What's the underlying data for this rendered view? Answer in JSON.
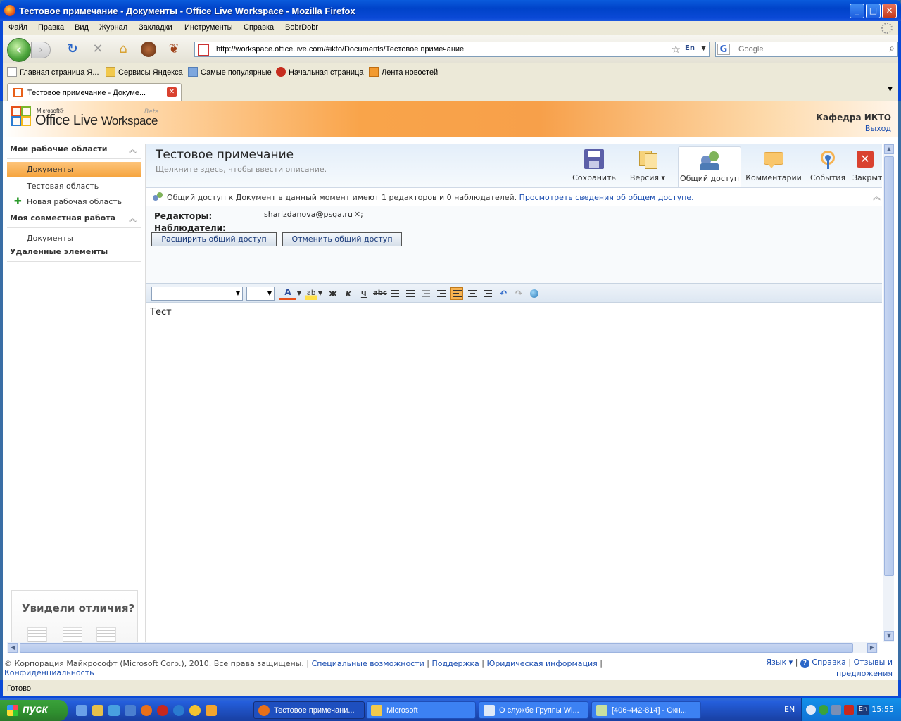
{
  "window": {
    "title": "Тестовое примечание - Документы - Office Live Workspace - Mozilla Firefox"
  },
  "menu": [
    "Файл",
    "Правка",
    "Вид",
    "Журнал",
    "Закладки",
    "Инструменты",
    "Справка",
    "BobrDobr"
  ],
  "nav": {
    "url": "http://workspace.office.live.com/#ikto/Documents/Тестовое примечание",
    "url_lang": "En",
    "search_placeholder": "Google"
  },
  "bookmarks": [
    "Главная страница Я...",
    "Сервисы Яндекса",
    "Самые популярные",
    "Начальная страница",
    "Лента новостей"
  ],
  "tab": {
    "label": "Тестовое примечание - Докуме..."
  },
  "brand": {
    "microsoft": "Microsoft®",
    "office_live": "Office Live",
    "workspace": "Workspace",
    "beta": "Beta"
  },
  "account": {
    "org": "Кафедра ИКТО",
    "logout": "Выход"
  },
  "sidebar": {
    "section1": "Мои рабочие области",
    "items1": [
      "Документы",
      "Тестовая область",
      "Новая рабочая область"
    ],
    "section2": "Моя совместная работа",
    "items2": [
      "Документы"
    ],
    "section3": "Удаленные элементы",
    "promo": "Увидели отличия?"
  },
  "document": {
    "title": "Тестовое примечание",
    "description": "Щелкните здесь, чтобы ввести описание.",
    "body": "Тест"
  },
  "toolbar": {
    "save": "Сохранить",
    "version": "Версия",
    "share": "Общий доступ",
    "comments": "Комментарии",
    "events": "События",
    "close": "Закрыть"
  },
  "share": {
    "info": "Общий доступ к Документ в данный момент имеют 1 редакторов и 0 наблюдателей.",
    "info_link": "Просмотреть сведения об общем доступе.",
    "editors_label": "Редакторы:",
    "viewers_label": "Наблюдатели:",
    "editor_email": "sharizdanova@psga.ru",
    "expand_button": "Расширить общий доступ",
    "cancel_button": "Отменить общий доступ"
  },
  "format": {
    "bold": "ж",
    "italic": "к",
    "underline": "ч",
    "strike": "abc"
  },
  "footer": {
    "copyright": "© Корпорация Майкрософт (Microsoft Corp.), 2010. Все права защищены.",
    "links": [
      "Специальные возможности",
      "Поддержка",
      "Юридическая информация",
      "Конфиденциальность"
    ],
    "language": "Язык",
    "help": "Справка",
    "feedback1": "Отзывы и",
    "feedback2": "предложения"
  },
  "status": "Готово",
  "taskbar": {
    "start": "пуск",
    "tasks": [
      "Тестовое примечани...",
      "Microsoft",
      "О службе Группы Wi...",
      "[406-442-814] - Окн..."
    ],
    "lang": "EN",
    "tray_lang": "En",
    "clock": "15:55"
  }
}
